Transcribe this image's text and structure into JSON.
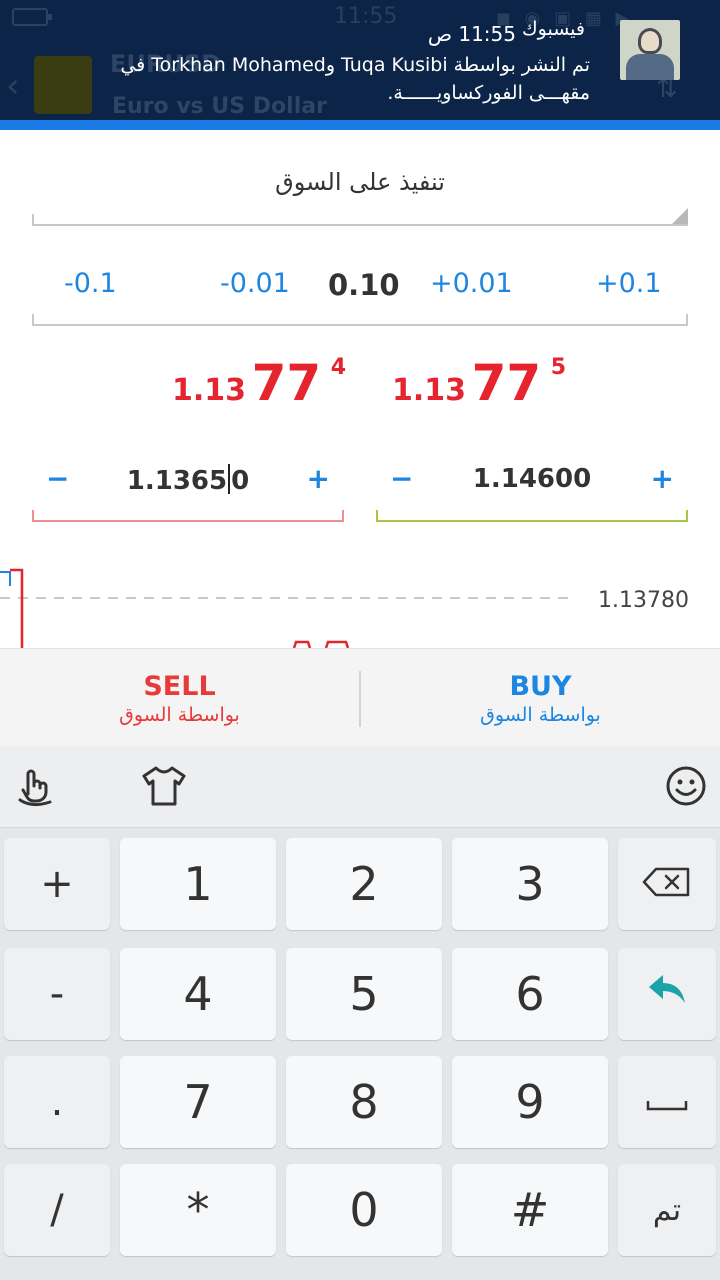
{
  "status_bar": {
    "time": "11:55",
    "icons": "◼ ◉ ▣ ▦ ▶"
  },
  "background_app": {
    "pair_code": "EURUSD",
    "pair_name": "Euro vs US Dollar"
  },
  "notification": {
    "app": "فيسبوك",
    "time": "11:55 ص",
    "line1": "تم النشر بواسطة Tuqa Kusibi وTorkhan Mohamed في",
    "line2": "مقهـــى الفوركساويــــــة."
  },
  "order": {
    "execution_type": "تنفيذ على السوق",
    "volume": {
      "minus_01": "-0.1",
      "minus_001": "-0.01",
      "value": "0.10",
      "plus_001": "+0.01",
      "plus_01": "+0.1"
    },
    "sell_price": {
      "prefix": "1.13",
      "pips": "77",
      "point": "4"
    },
    "buy_price": {
      "prefix": "1.13",
      "pips": "77",
      "point": "5"
    },
    "stop_loss": {
      "minus": "−",
      "value_before_cursor": "1.1365",
      "value_after_cursor": "0",
      "plus": "+"
    },
    "take_profit": {
      "minus": "−",
      "value": "1.14600",
      "plus": "+"
    }
  },
  "chart": {
    "price_label": "1.13780",
    "colors": {
      "line": "#1f86e0",
      "candle": "#e5242d",
      "dashed": "#c8c8c8"
    }
  },
  "trade_buttons": {
    "sell": {
      "label": "SELL",
      "sub": "بواسطة السوق",
      "color": "#e83a3a"
    },
    "buy": {
      "label": "BUY",
      "sub": "بواسطة السوق",
      "color": "#1c86e0"
    }
  },
  "keyboard": {
    "toolbar": [
      "swipe-icon",
      "theme-shirt-icon",
      "emoji-icon"
    ],
    "rows": [
      [
        "+",
        "1",
        "2",
        "3",
        "backspace"
      ],
      [
        "-",
        "4",
        "5",
        "6",
        "enter"
      ],
      [
        ".",
        "7",
        "8",
        "9",
        "space"
      ],
      [
        "/",
        "*",
        "0",
        "#",
        "تم"
      ]
    ]
  },
  "colors": {
    "accent": "#1b7ae6",
    "price_red": "#e5242d",
    "link_blue": "#1f86e0",
    "sl_underline": "#f08f8f",
    "tp_underline": "#a6c845"
  }
}
